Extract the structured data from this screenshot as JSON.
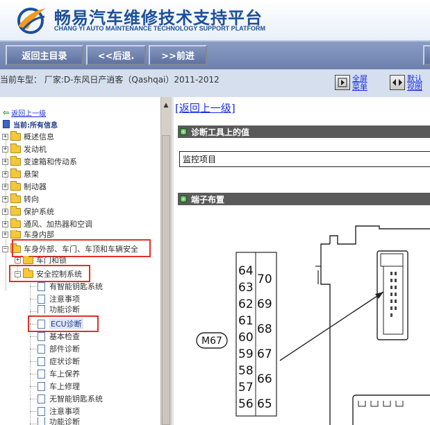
{
  "header": {
    "title": "畅易汽车维修技术支持平台",
    "subtitle": "CHANG YI AUTO MAINTENANCE TECHNOLOGY SUPPORT PLATFORM"
  },
  "toolbar": {
    "home_label": "返回主目录",
    "back_label": "<<后退.",
    "forward_label": ">>前进"
  },
  "vehicle": {
    "label": "当前车型： 厂家:D-东风日产逍客（Qashqai）2011-2012",
    "fullscreen_label": "全屏菜单",
    "default_view_label": "默认视图"
  },
  "tree": {
    "up_label": "返回上一级",
    "current_label": "当前:所有信息",
    "top_items": [
      "概述信息",
      "发动机",
      "变速箱和传动系",
      "悬架",
      "制动器",
      "转向",
      "保护系统",
      "通风、加热器和空调",
      "车身内部"
    ],
    "body_exterior": "车身外部、车门、车顶和车辆安全",
    "door_hw": "车门和锁",
    "safety_system": "安全控制系统",
    "leaves": [
      "有智能钥匙系统",
      "注意事项",
      "功能诊断",
      "ECU诊断",
      "基本检查",
      "部件诊断",
      "症状诊断",
      "车上保养",
      "车上修理",
      "无智能钥匙系统",
      "注意事项",
      "功能诊断"
    ],
    "selected_index": 3
  },
  "content": {
    "up_link": "[返回上一级]",
    "section_diag": "诊断工具上的值",
    "monitor_label": "监控项目",
    "section_pin": "端子布置",
    "connector_label": "M67",
    "pins_left": [
      "64",
      "63",
      "62",
      "61",
      "60",
      "59",
      "58",
      "57",
      "56"
    ],
    "pins_right": [
      "70",
      "69",
      "68",
      "67",
      "66",
      "65"
    ]
  },
  "colors": {
    "brand": "#1c4f9c",
    "toolbar": "#6d80ad",
    "highlight": "#e0302a",
    "link": "#1a2ee0"
  }
}
